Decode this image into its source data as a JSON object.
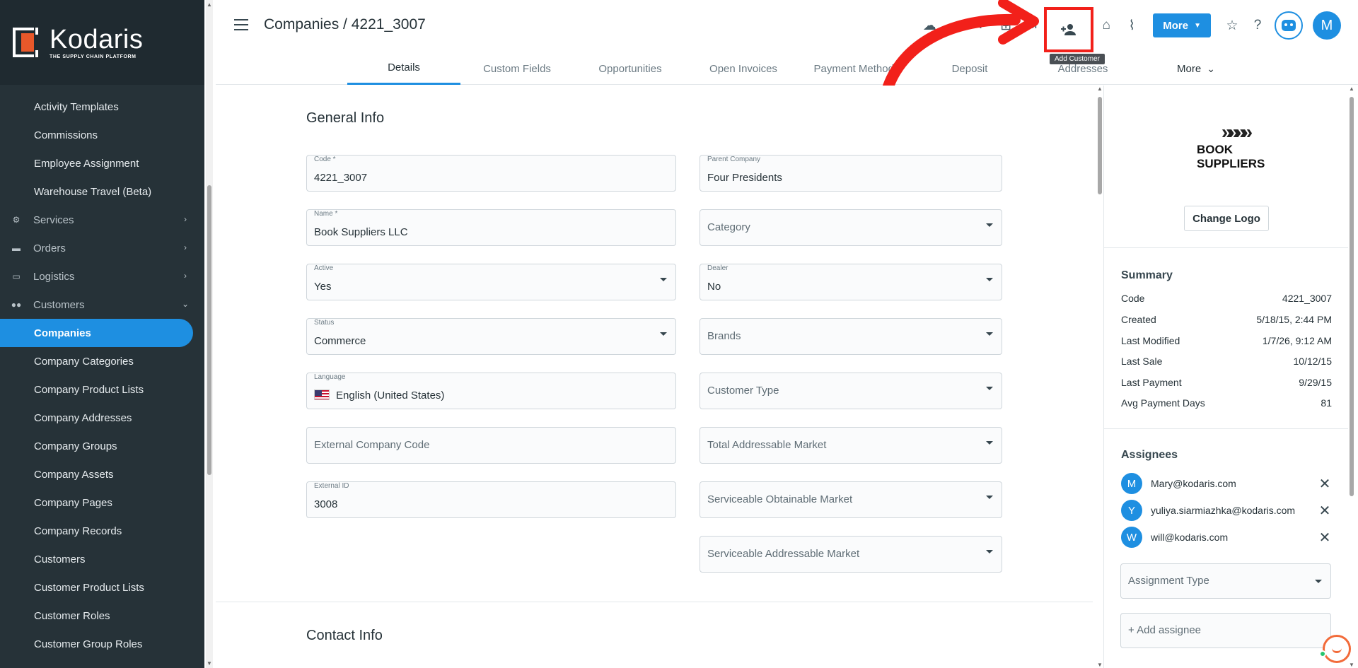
{
  "brand": {
    "name": "Kodaris",
    "tagline": "THE SUPPLY CHAIN PLATFORM",
    "accent": "#e8582a"
  },
  "sidebar": {
    "items": [
      {
        "label": "Activity Templates",
        "type": "sub"
      },
      {
        "label": "Commissions",
        "type": "sub"
      },
      {
        "label": "Employee Assignment",
        "type": "sub"
      },
      {
        "label": "Warehouse Travel (Beta)",
        "type": "sub"
      },
      {
        "label": "Services",
        "type": "group",
        "icon": "gears-icon"
      },
      {
        "label": "Orders",
        "type": "group",
        "icon": "truck-icon"
      },
      {
        "label": "Logistics",
        "type": "group",
        "icon": "car-icon"
      },
      {
        "label": "Customers",
        "type": "group",
        "icon": "people-icon"
      },
      {
        "label": "Companies",
        "type": "sub",
        "active": true
      },
      {
        "label": "Company Categories",
        "type": "sub"
      },
      {
        "label": "Company Product Lists",
        "type": "sub"
      },
      {
        "label": "Company Addresses",
        "type": "sub"
      },
      {
        "label": "Company Groups",
        "type": "sub"
      },
      {
        "label": "Company Assets",
        "type": "sub"
      },
      {
        "label": "Company Pages",
        "type": "sub"
      },
      {
        "label": "Company Records",
        "type": "sub"
      },
      {
        "label": "Customers",
        "type": "sub"
      },
      {
        "label": "Customer Product Lists",
        "type": "sub"
      },
      {
        "label": "Customer Roles",
        "type": "sub"
      },
      {
        "label": "Customer Group Roles",
        "type": "sub"
      }
    ]
  },
  "header": {
    "breadcrumb": "Companies / 4221_3007",
    "more_label": "More",
    "avatar_letter": "M",
    "tooltip": "Add Customer",
    "accent": "#1e8fe1",
    "highlight_color": "#f2201a"
  },
  "tabs": [
    {
      "label": "Details",
      "active": true
    },
    {
      "label": "Custom Fields"
    },
    {
      "label": "Opportunities"
    },
    {
      "label": "Open Invoices"
    },
    {
      "label": "Payment Methods"
    },
    {
      "label": "Deposit"
    },
    {
      "label": "Addresses"
    },
    {
      "label": "More"
    }
  ],
  "general_info": {
    "title": "General Info",
    "code": {
      "label": "Code *",
      "value": "4221_3007"
    },
    "name": {
      "label": "Name *",
      "value": "Book Suppliers LLC"
    },
    "active": {
      "label": "Active",
      "value": "Yes"
    },
    "status": {
      "label": "Status",
      "value": "Commerce"
    },
    "language": {
      "label": "Language",
      "value": "English (United States)"
    },
    "external_code": {
      "placeholder": "External Company Code"
    },
    "external_id": {
      "label": "External ID",
      "value": "3008"
    },
    "parent_company": {
      "label": "Parent Company",
      "value": "Four Presidents"
    },
    "category": {
      "placeholder": "Category"
    },
    "dealer": {
      "label": "Dealer",
      "value": "No"
    },
    "brands": {
      "placeholder": "Brands"
    },
    "customer_type": {
      "placeholder": "Customer Type"
    },
    "tam": {
      "placeholder": "Total Addressable Market"
    },
    "som": {
      "placeholder": "Serviceable Obtainable Market"
    },
    "sam": {
      "placeholder": "Serviceable Addressable Market"
    }
  },
  "contact_info": {
    "title": "Contact Info"
  },
  "right_panel": {
    "logo_line1": "BOOK",
    "logo_line2": "SUPPLIERS",
    "change_logo": "Change Logo",
    "summary_title": "Summary",
    "summary": [
      {
        "k": "Code",
        "v": "4221_3007"
      },
      {
        "k": "Created",
        "v": "5/18/15, 2:44 PM"
      },
      {
        "k": "Last Modified",
        "v": "1/7/26, 9:12 AM"
      },
      {
        "k": "Last Sale",
        "v": "10/12/15"
      },
      {
        "k": "Last Payment",
        "v": "9/29/15"
      },
      {
        "k": "Avg Payment Days",
        "v": "81"
      }
    ],
    "assignees_title": "Assignees",
    "assignees": [
      {
        "letter": "M",
        "email": "Mary@kodaris.com"
      },
      {
        "letter": "Y",
        "email": "yuliya.siarmiazhka@kodaris.com"
      },
      {
        "letter": "W",
        "email": "will@kodaris.com"
      }
    ],
    "assignment_type": "Assignment Type",
    "add_assignee": "+ Add assignee"
  }
}
